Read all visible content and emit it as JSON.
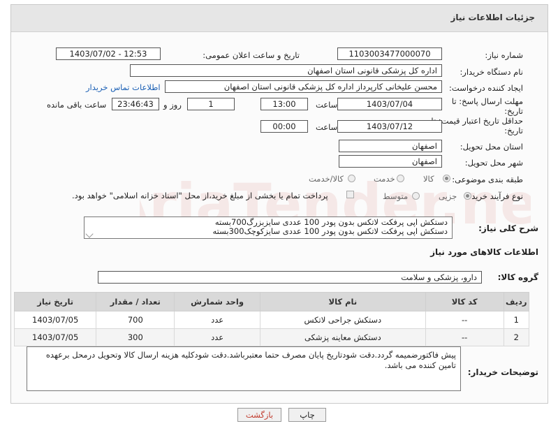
{
  "header": {
    "title": "جزئیات اطلاعات نیاز"
  },
  "form": {
    "need_number": {
      "label": "شماره نیاز:",
      "value": "1103003477000070"
    },
    "announce_datetime": {
      "label": "تاریخ و ساعت اعلان عمومی:",
      "value": "1403/07/02 - 12:53"
    },
    "buyer_org": {
      "label": "نام دستگاه خریدار:",
      "value": "اداره کل پزشکی قانونی استان اصفهان"
    },
    "requester": {
      "label": "ایجاد کننده درخواست:",
      "value": "محسن علیخانی کارپرداز اداره کل پزشکی قانونی استان اصفهان",
      "contact_link": "اطلاعات تماس خریدار"
    },
    "reply_deadline": {
      "label_line1": "مهلت ارسال پاسخ: تا",
      "label_line2": "تاریخ:",
      "date": "1403/07/04",
      "time_label": "ساعت",
      "time": "13:00",
      "days": "1",
      "days_label": "روز و",
      "remaining": "23:46:43",
      "remaining_label": "ساعت باقی مانده"
    },
    "price_validity": {
      "label_line1": "حداقل تاریخ اعتبار قیمت: تا",
      "label_line2": "تاریخ:",
      "date": "1403/07/12",
      "time_label": "ساعت",
      "time": "00:00"
    },
    "delivery_province": {
      "label": "استان محل تحویل:",
      "value": "اصفهان"
    },
    "delivery_city": {
      "label": "شهر محل تحویل:",
      "value": "اصفهان"
    },
    "category": {
      "label": "طبقه بندی موضوعی:",
      "options": [
        "کالا",
        "خدمت",
        "کالا/خدمت"
      ],
      "selected": "کالا"
    },
    "process": {
      "label": "نوع فرآیند خرید :",
      "options": [
        "جزیی",
        "متوسط"
      ],
      "selected": "جزیی",
      "payment_note": "پرداخت تمام یا بخشی از مبلغ خرید،از محل \"اسناد خزانه اسلامی\" خواهد بود."
    }
  },
  "summary": {
    "label": "شرح کلی نیاز:",
    "lines": [
      "دستکش  اپی پرفکت لاتکس بدون پودر 100 عددی  سایزبزرگ700بسته",
      "دستکش  اپی پرفکت لاتکس بدون پودر 100 عددی  سایزکوچک300بسته"
    ]
  },
  "goods_section": {
    "title": "اطلاعات کالاهای مورد نیاز"
  },
  "goods_group": {
    "label": "گروه کالا:",
    "value": "دارو، پزشکی و سلامت"
  },
  "table": {
    "headers": [
      "ردیف",
      "کد کالا",
      "نام کالا",
      "واحد شمارش",
      "تعداد / مقدار",
      "تاریخ نیاز"
    ],
    "rows": [
      [
        "1",
        "--",
        "دستکش جراحی لاتکس",
        "عدد",
        "700",
        "1403/07/05"
      ],
      [
        "2",
        "--",
        "دستکش معاینه پزشکی",
        "عدد",
        "300",
        "1403/07/05"
      ]
    ]
  },
  "notes": {
    "label": "توضیحات خریدار:",
    "text": "پیش فاکتورضمیمه گردد.دقت شودتاریخ پایان مصرف حتما معتبرباشد.دقت شودکلیه هزینه ارسال کالا وتحویل درمحل برعهده تامین کننده می باشد."
  },
  "buttons": {
    "print": "چاپ",
    "back": "بازگشت"
  },
  "colors": {
    "link": "#1a5fb4",
    "back_button_text": "#c0392b",
    "header_bg": "#e6e6e6"
  }
}
